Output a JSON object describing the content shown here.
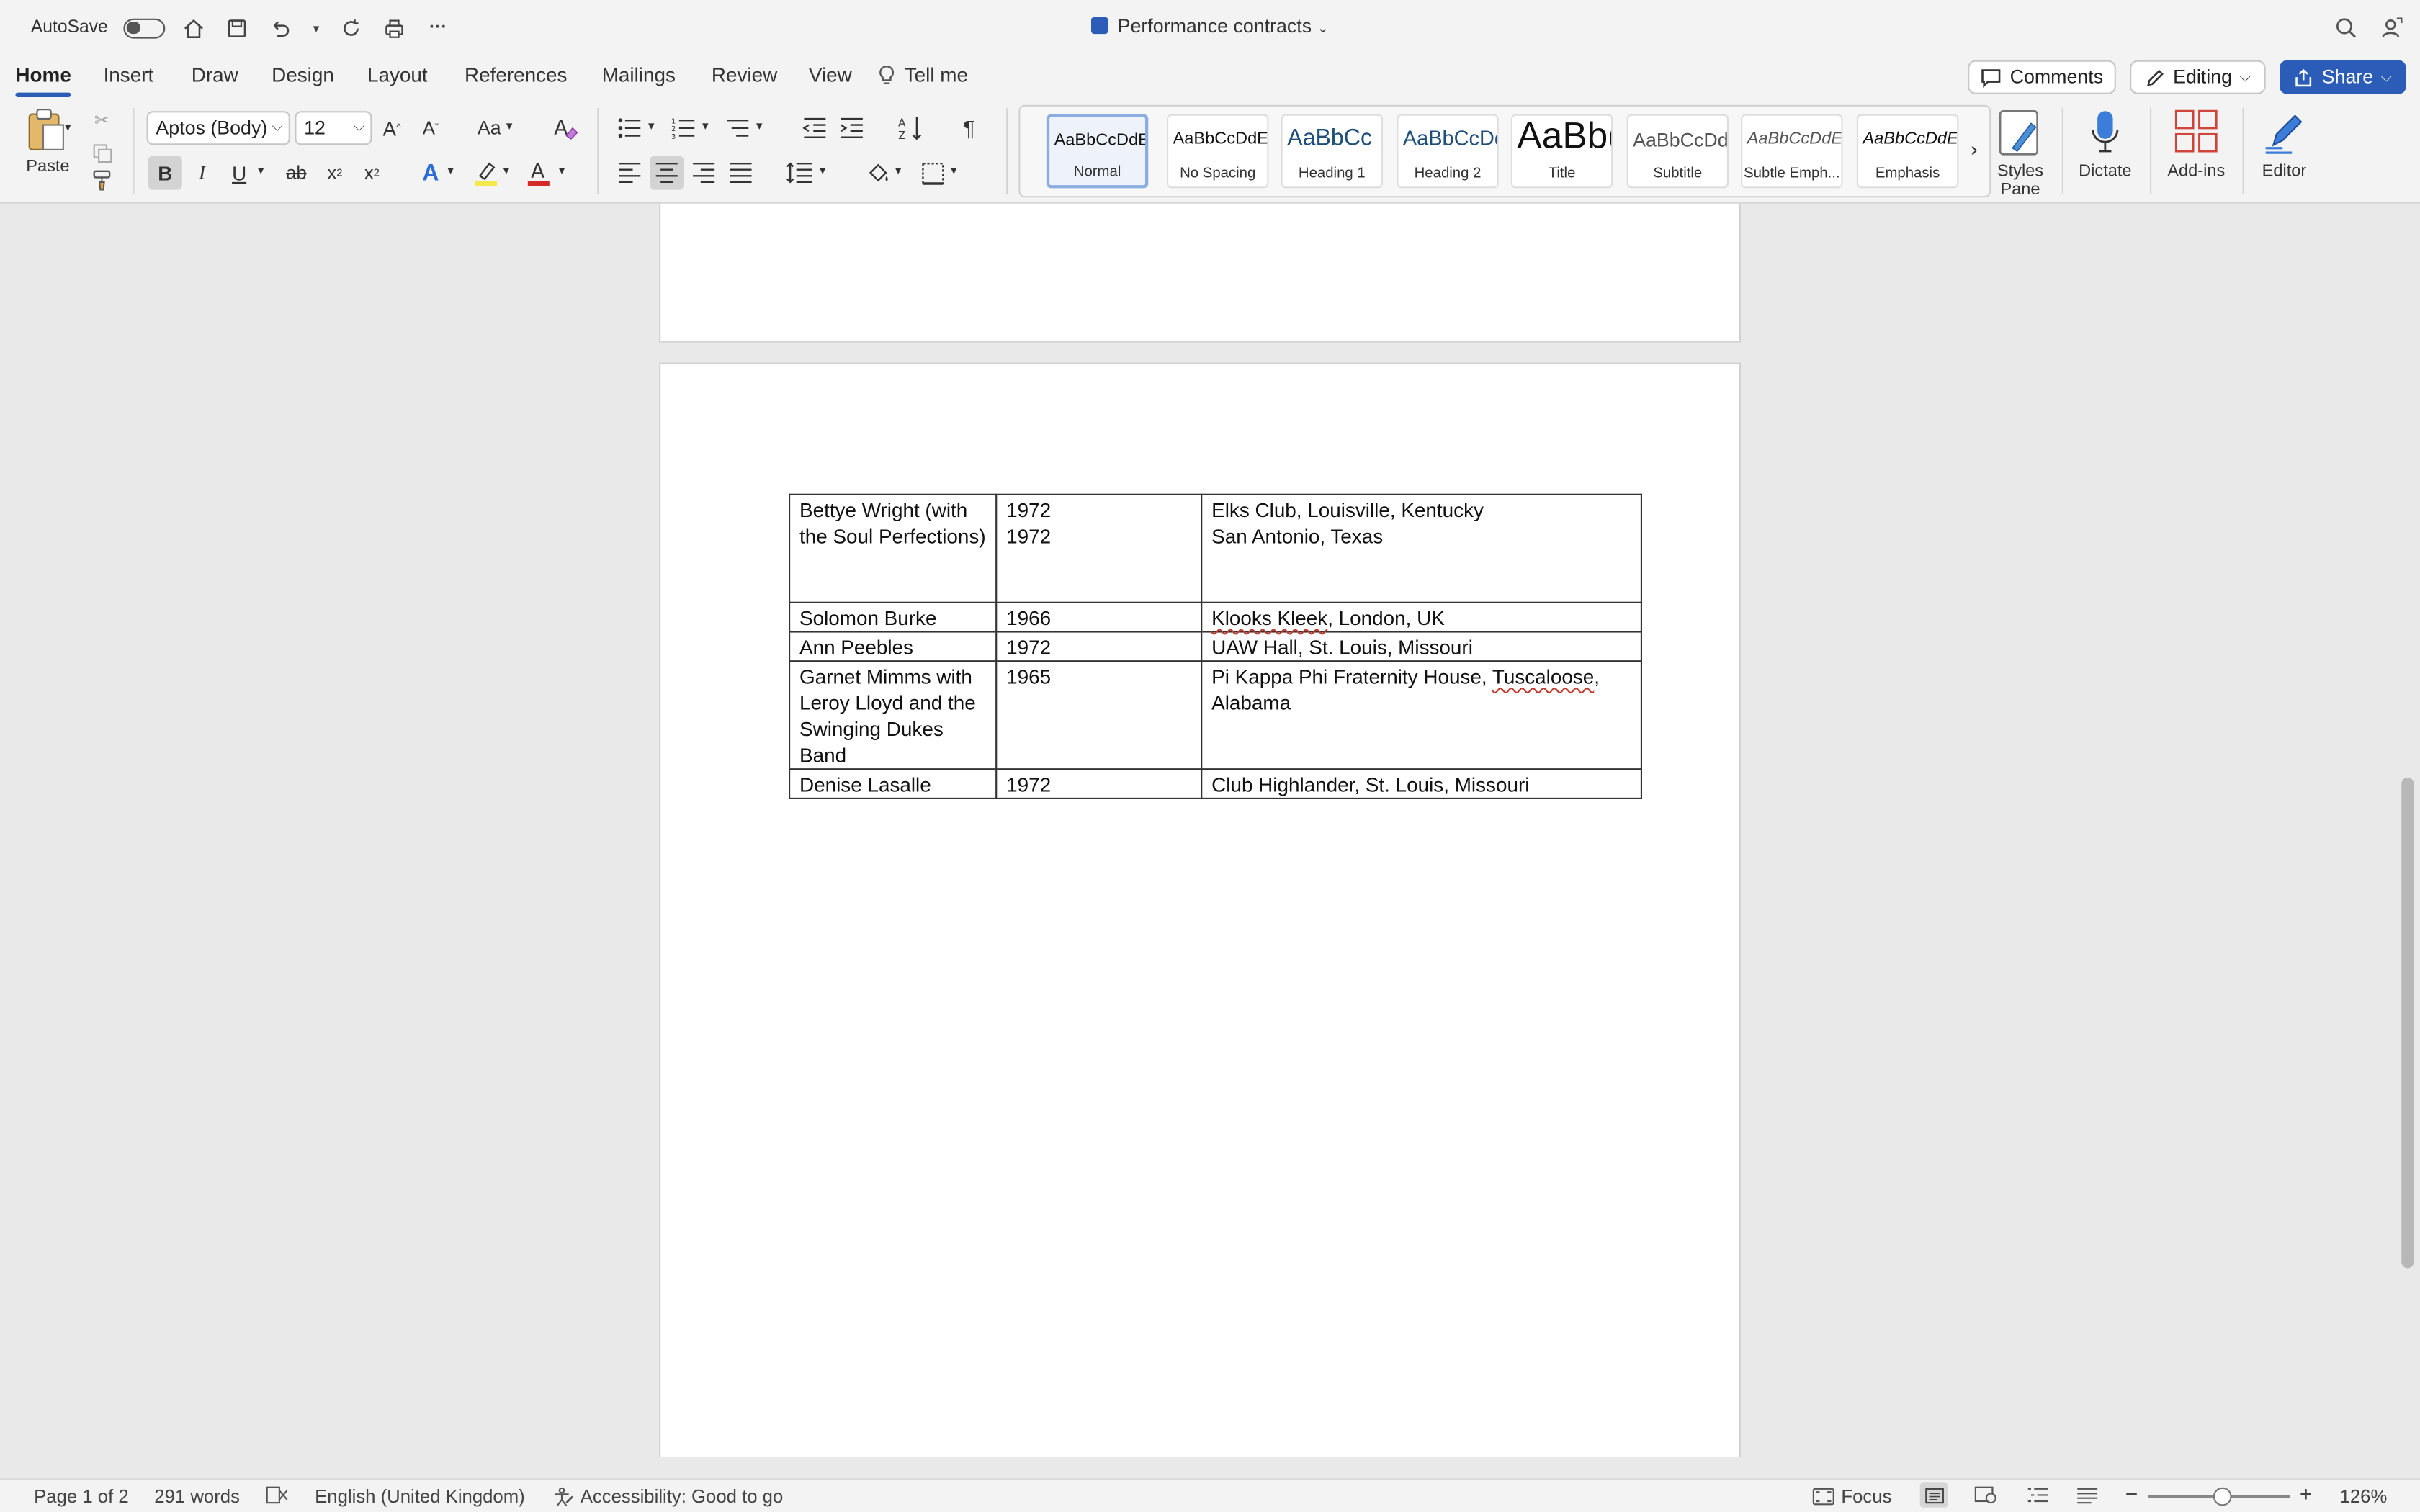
{
  "titlebar": {
    "autosave_label": "AutoSave",
    "document_title": "Performance contracts"
  },
  "tabs": [
    "Home",
    "Insert",
    "Draw",
    "Design",
    "Layout",
    "References",
    "Mailings",
    "Review",
    "View"
  ],
  "tell_me": "Tell me",
  "actions": {
    "comments": "Comments",
    "editing": "Editing",
    "share": "Share"
  },
  "ribbon": {
    "paste_label": "Paste",
    "font_name": "Aptos (Body)",
    "font_size": "12",
    "change_case_label": "Aa",
    "bold": "B",
    "italic": "I",
    "underline": "U",
    "strikethrough": "ab",
    "subscript": "x",
    "superscript": "x",
    "styles": [
      {
        "sample": "AaBbCcDdEe",
        "name": "Normal"
      },
      {
        "sample": "AaBbCcDdEe",
        "name": "No Spacing"
      },
      {
        "sample": "AaBbCc",
        "name": "Heading 1"
      },
      {
        "sample": "AaBbCcDd",
        "name": "Heading 2"
      },
      {
        "sample": "AaBb(",
        "name": "Title"
      },
      {
        "sample": "AaBbCcDd",
        "name": "Subtitle"
      },
      {
        "sample": "AaBbCcDdEe",
        "name": "Subtle Emph..."
      },
      {
        "sample": "AaBbCcDdEe",
        "name": "Emphasis"
      }
    ],
    "styles_pane": "Styles Pane",
    "dictate": "Dictate",
    "addins": "Add-ins",
    "editor": "Editor"
  },
  "table": {
    "rows": [
      {
        "artist": "Bettye Wright (with the Soul Perfections)",
        "year": "1972",
        "year2": "1972",
        "venue": "Elks Club, Louisville, Kentucky",
        "venue2": "San Antonio, Texas"
      },
      {
        "artist": "Solomon Burke",
        "year": "1966",
        "venue_pre": "",
        "venue_squiggle": "Klooks Kleek",
        "venue_post": ", London, UK"
      },
      {
        "artist": "Ann Peebles",
        "year": "1972",
        "venue": "UAW Hall, St. Louis, Missouri"
      },
      {
        "artist": "Garnet Mimms with Leroy Lloyd and the Swinging Dukes Band",
        "year": "1965",
        "venue_pre": "Pi Kappa Phi Fraternity House, ",
        "venue_squiggle": "Tuscaloose",
        "venue_post": ", Alabama"
      },
      {
        "artist": "Denise Lasalle",
        "year": "1972",
        "venue": "Club Highlander, St. Louis, Missouri"
      }
    ]
  },
  "statusbar": {
    "page": "Page 1 of 2",
    "words": "291 words",
    "language": "English (United Kingdom)",
    "accessibility": "Accessibility: Good to go",
    "focus": "Focus",
    "zoom": "126%"
  }
}
